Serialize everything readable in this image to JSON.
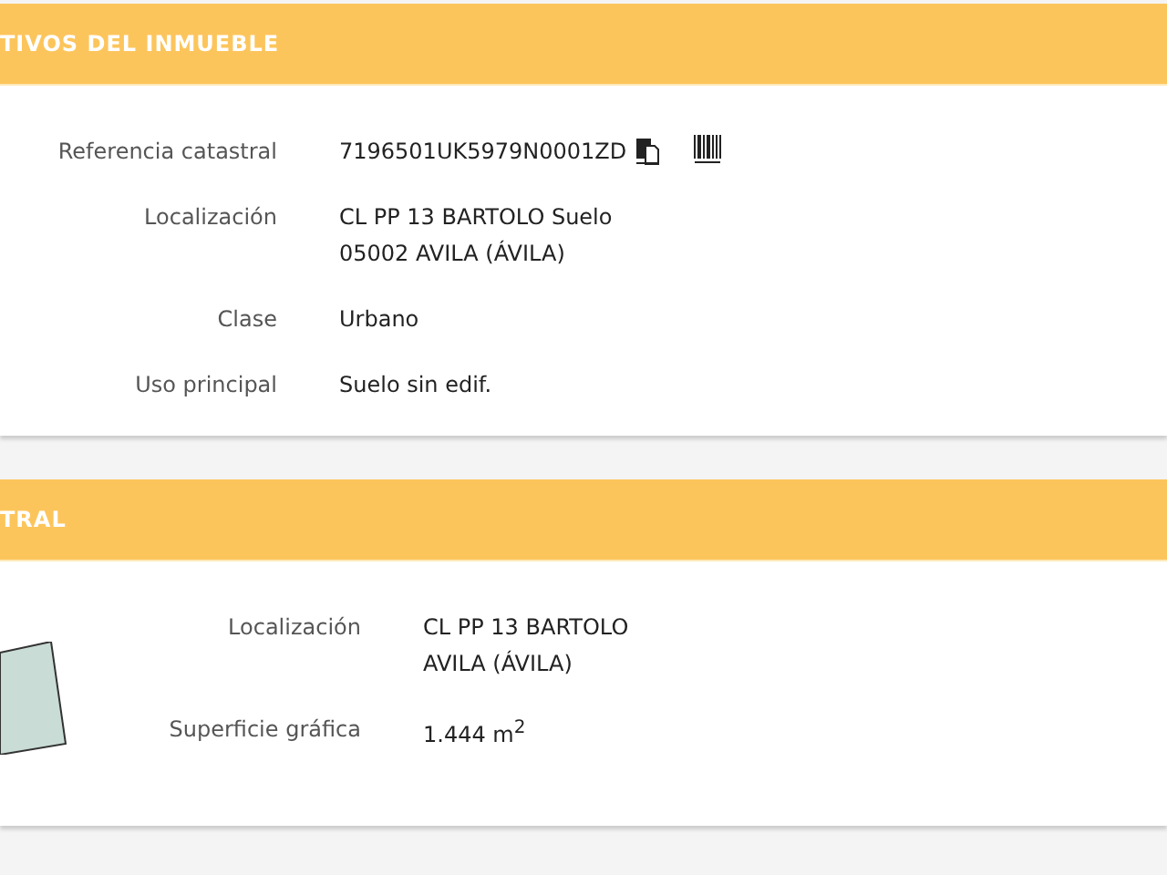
{
  "panels": [
    {
      "title": "TIVOS DEL INMUEBLE",
      "kind": "data",
      "rows": [
        {
          "label": "Referencia catastral",
          "lines": [
            "7196501UK5979N0001ZD"
          ],
          "actions": [
            {
              "kind": "copy"
            },
            {
              "kind": "barcode"
            }
          ]
        },
        {
          "label": "Localización",
          "lines": [
            "CL PP 13 BARTOLO Suelo",
            "05002 AVILA (ÁVILA)"
          ]
        },
        {
          "label": "Clase",
          "lines": [
            "Urbano"
          ]
        },
        {
          "label": "Uso principal",
          "lines": [
            "Suelo sin edif."
          ]
        }
      ]
    },
    {
      "title": "TRAL",
      "kind": "parcel",
      "rows": [
        {
          "label": "Localización",
          "lines": [
            "CL PP 13 BARTOLO",
            "AVILA (ÁVILA)"
          ]
        },
        {
          "label": "Superficie gráfica",
          "lines": [
            "1.444 m$^{2}$"
          ]
        }
      ]
    }
  ]
}
